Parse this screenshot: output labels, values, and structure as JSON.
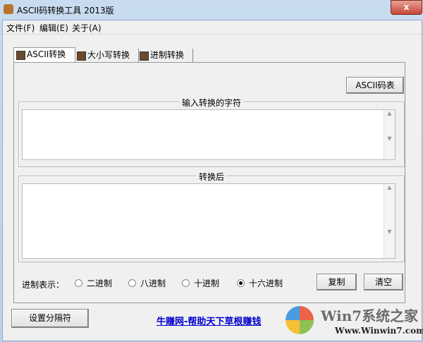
{
  "window": {
    "title": "ASCII码转换工具 2013版",
    "close": "x"
  },
  "menu": [
    "文件(F)",
    "编辑(E)",
    "关于(A)"
  ],
  "tabs": [
    "ASCII转换",
    "大小写转换",
    "进制转换"
  ],
  "ascii_table_button": "ASCII码表",
  "input_group": {
    "label": "输入转换的字符",
    "value": ""
  },
  "output_group": {
    "label": "转换后",
    "value": ""
  },
  "radix": {
    "label": "进制表示：",
    "options": [
      "二进制",
      "八进制",
      "十进制",
      "十六进制"
    ],
    "selected": 3
  },
  "copy_button": "复制",
  "clear_button": "清空",
  "separator_button": "设置分隔符",
  "link": "牛赚网-帮助天下草根赚钱",
  "watermark": {
    "brand": "Win7系统之家",
    "url": "Www.Winwin7.com"
  }
}
